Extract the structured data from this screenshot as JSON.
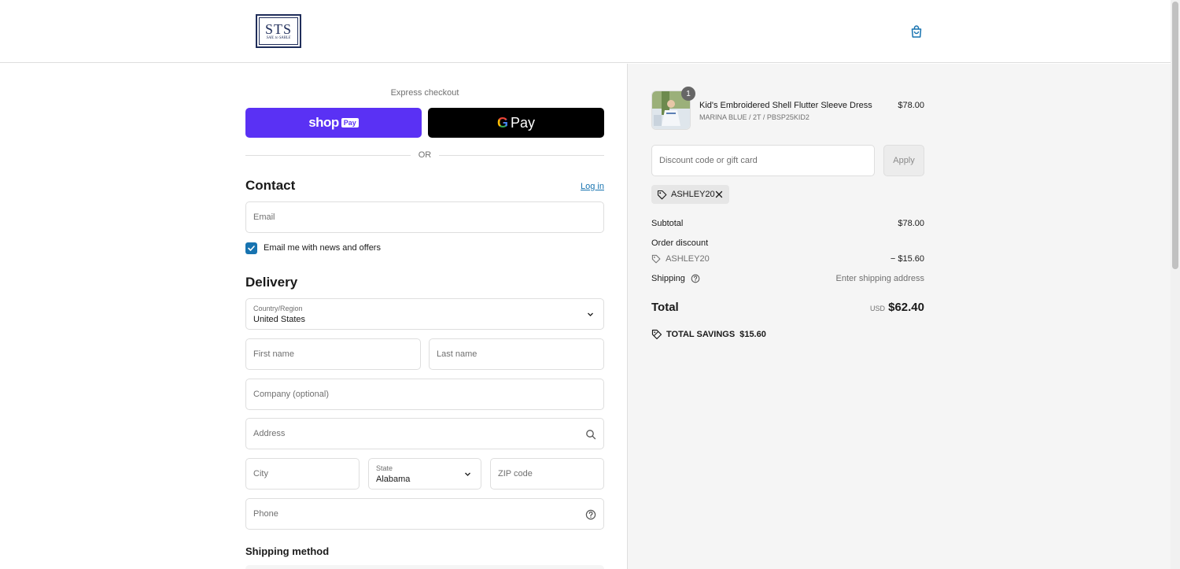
{
  "brand": {
    "logo_main": "STS",
    "logo_sub": "SAIL to SABLE"
  },
  "express": {
    "title": "Express checkout",
    "shoppay_label": "shop",
    "shoppay_badge": "Pay",
    "gpay_label": "Pay",
    "gpay_g": "G",
    "or": "OR"
  },
  "contact": {
    "title": "Contact",
    "login": "Log in",
    "email_placeholder": "Email",
    "newsletter_label": "Email me with news and offers",
    "newsletter_checked": true
  },
  "delivery": {
    "title": "Delivery",
    "country_label": "Country/Region",
    "country_value": "United States",
    "first_name": "First name",
    "last_name": "Last name",
    "company": "Company (optional)",
    "address": "Address",
    "city": "City",
    "state_label": "State",
    "state_value": "Alabama",
    "zip": "ZIP code",
    "phone": "Phone"
  },
  "shipping_method": {
    "title": "Shipping method"
  },
  "summary": {
    "item": {
      "qty": "1",
      "name": "Kid's Embroidered Shell Flutter Sleeve Dress",
      "variant": "MARINA BLUE / 2T / PBSP25KID2",
      "price": "$78.00"
    },
    "discount_placeholder": "Discount code or gift card",
    "apply": "Apply",
    "applied_code": "ASHLEY20",
    "subtotal_label": "Subtotal",
    "subtotal_value": "$78.00",
    "order_discount_label": "Order discount",
    "discount_code": "ASHLEY20",
    "discount_value": "− $15.60",
    "shipping_label": "Shipping",
    "shipping_value": "Enter shipping address",
    "total_label": "Total",
    "currency": "USD",
    "total_value": "$62.40",
    "savings_label": "TOTAL SAVINGS",
    "savings_value": "$15.60"
  },
  "colors": {
    "shoppay": "#5a31f4",
    "link": "#1773b0",
    "summary_bg": "#f5f5f5"
  }
}
